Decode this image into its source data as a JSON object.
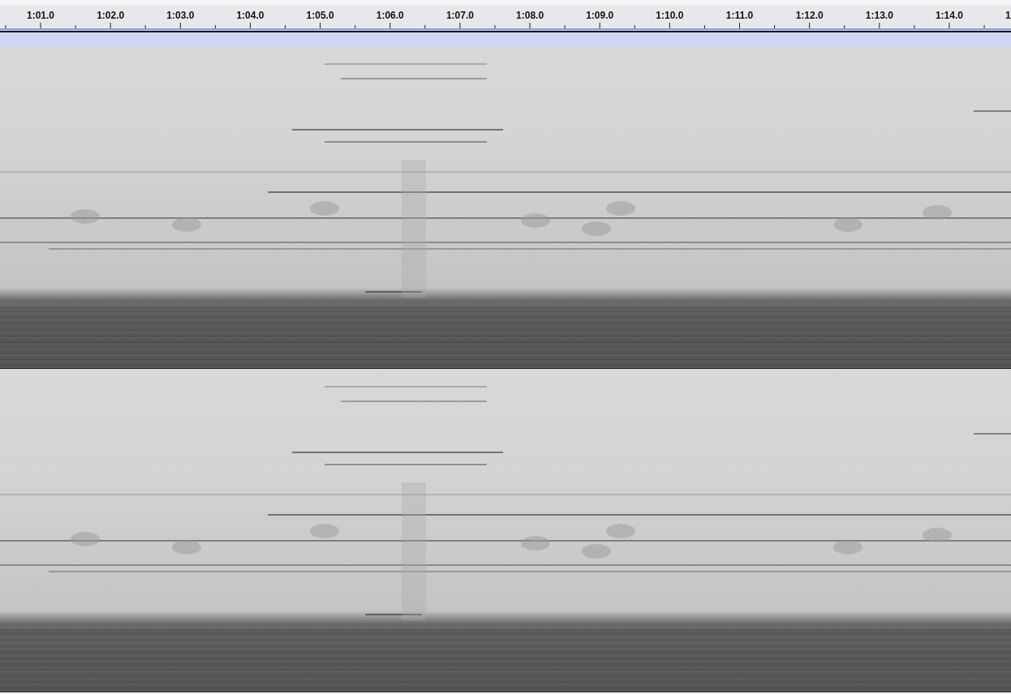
{
  "ruler": {
    "labels": [
      "1:01.0",
      "1:02.0",
      "1:03.0",
      "1:04.0",
      "1:05.0",
      "1:06.0",
      "1:07.0",
      "1:08.0",
      "1:09.0",
      "1:10.0",
      "1:11.0",
      "1:12.0",
      "1:13.0",
      "1:14.0",
      "1"
    ]
  }
}
